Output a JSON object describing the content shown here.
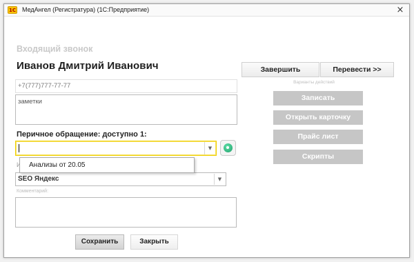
{
  "window": {
    "title": "МедАнгел (Регистратура)  (1С:Предприятие)",
    "close_glyph": "×",
    "app_icon_text": "1С"
  },
  "call": {
    "section_title": "Входящий звонок",
    "caller_name": "Иванов Дмитрий Иванович",
    "phone": "+7(777)777-77-77",
    "notes": "заметки"
  },
  "primary": {
    "label": "Перичное обращение: доступно 1:",
    "value": "",
    "dropdown_items": [
      "Анализы от 20.05"
    ]
  },
  "source": {
    "partial_label": "И",
    "value": "SEO Яндекс"
  },
  "comment": {
    "label": "Комментарий:",
    "value": ""
  },
  "actions": {
    "finish": "Завершить",
    "transfer": "Перевести >>",
    "variants_label": "Варианты действий",
    "record": "Записать",
    "open_card": "Открыть карточку",
    "price_list": "Прайс лист",
    "scripts": "Скрипты"
  },
  "footer": {
    "save": "Сохранить",
    "close": "Закрыть"
  },
  "icons": {
    "app": "1c-app-icon",
    "close": "close-icon",
    "dropdown": "chevron-down-icon",
    "search": "search-icon"
  },
  "colors": {
    "focus_border": "#f0d000",
    "disabled_button": "#c6c6c6",
    "search_green": "#1f9f6a"
  }
}
